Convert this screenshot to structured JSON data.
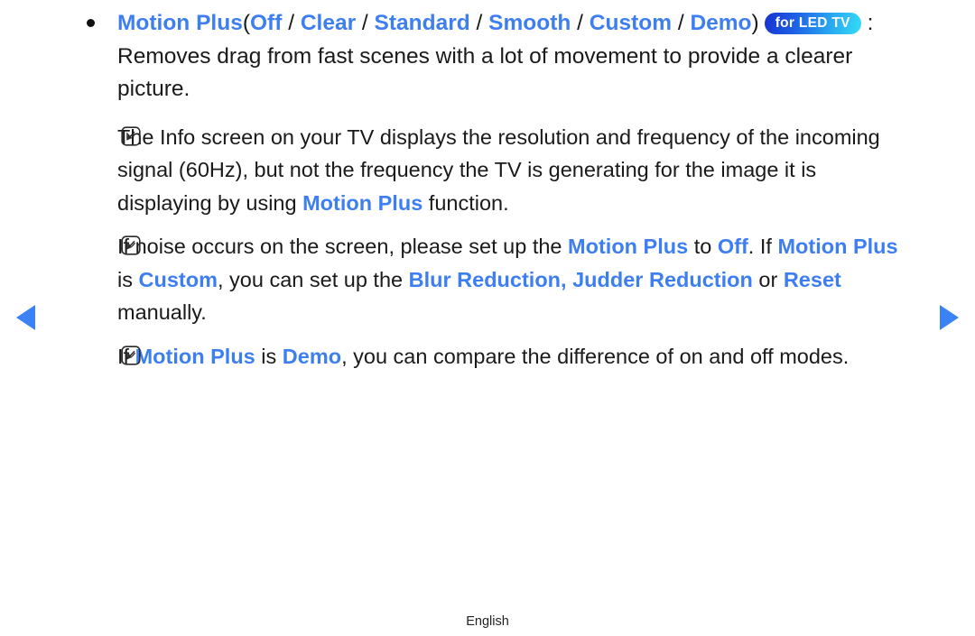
{
  "page": {
    "footer_label": "English",
    "accent_blue": "#3d7ef0",
    "arrow_blue": "#3b82f6",
    "text_black": "#1a1a1a"
  },
  "navigation": {
    "prev_icon": "triangle-left-icon",
    "next_icon": "triangle-right-icon"
  },
  "badge": {
    "label": "for LED TV",
    "gradient_from": "#1733cf",
    "gradient_to": "#35dcf7"
  },
  "bullet": {
    "marker": "•",
    "title": "Motion Plus",
    "paren_open": "(",
    "options": [
      "Off",
      "Clear",
      "Standard",
      "Smooth",
      "Custom",
      "Demo"
    ],
    "separator": "/",
    "paren_close": ")",
    "description": ": Removes drag from fast scenes with a lot of movement to provide a clearer picture."
  },
  "notes": [
    {
      "icon": "note-pencil-icon",
      "segments": [
        {
          "text": "The Info screen on your TV displays the resolution and frequency of the incoming signal (60Hz), but not the frequency the TV is generating for the image it is displaying by using ",
          "style": "plain"
        },
        {
          "text": "Motion Plus",
          "style": "accent"
        },
        {
          "text": " function.",
          "style": "plain"
        }
      ]
    },
    {
      "icon": "note-pencil-icon",
      "segments": [
        {
          "text": "If noise occurs on the screen, please set up the ",
          "style": "plain"
        },
        {
          "text": "Motion Plus",
          "style": "accent"
        },
        {
          "text": " to ",
          "style": "plain"
        },
        {
          "text": "Off",
          "style": "accent"
        },
        {
          "text": ". If ",
          "style": "plain"
        },
        {
          "text": "Motion Plus",
          "style": "accent"
        },
        {
          "text": " is ",
          "style": "plain"
        },
        {
          "text": "Custom",
          "style": "accent"
        },
        {
          "text": ", you can set up the ",
          "style": "plain"
        },
        {
          "text": "Blur Reduction, Judder Reduction",
          "style": "accent"
        },
        {
          "text": " or ",
          "style": "plain"
        },
        {
          "text": "Reset",
          "style": "accent"
        },
        {
          "text": " manually.",
          "style": "plain"
        }
      ]
    },
    {
      "icon": "note-pencil-icon",
      "segments": [
        {
          "text": "If ",
          "style": "plain"
        },
        {
          "text": "Motion Plus",
          "style": "accent"
        },
        {
          "text": " is ",
          "style": "plain"
        },
        {
          "text": "Demo",
          "style": "accent"
        },
        {
          "text": ", you can compare the difference of on and off modes.",
          "style": "plain"
        }
      ]
    }
  ]
}
